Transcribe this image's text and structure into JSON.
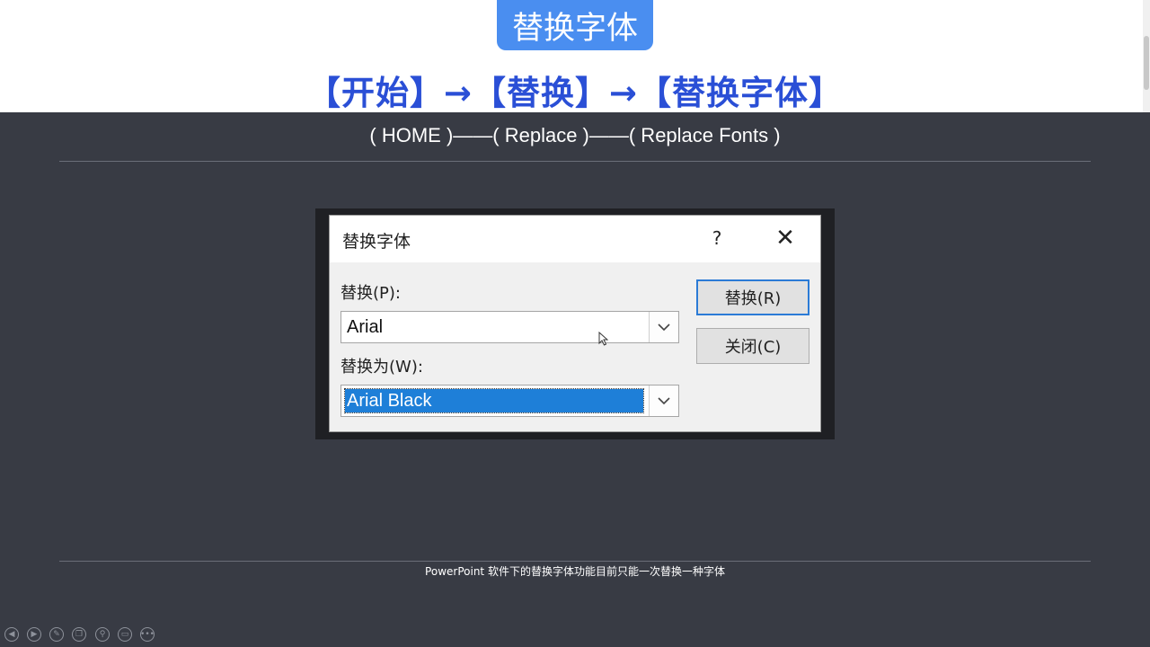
{
  "slide": {
    "badge_title": "替换字体",
    "path_zh": "【开始】→【替换】→【替换字体】",
    "path_en": "( HOME )——( Replace )——( Replace Fonts )",
    "footnote": "PowerPoint 软件下的替换字体功能目前只能一次替换一种字体"
  },
  "dialog": {
    "title": "替换字体",
    "help": "?",
    "close": "✕",
    "replace_label": "替换(P):",
    "replace_value": "Arial",
    "with_label": "替换为(W):",
    "with_value": "Arial Black",
    "replace_button": "替换(R)",
    "close_button": "关闭(C)"
  },
  "colors": {
    "badge": "#4a8ef0",
    "path_text": "#2a4fd6",
    "slide_bg": "#383b44",
    "selection": "#1e7fd8"
  }
}
